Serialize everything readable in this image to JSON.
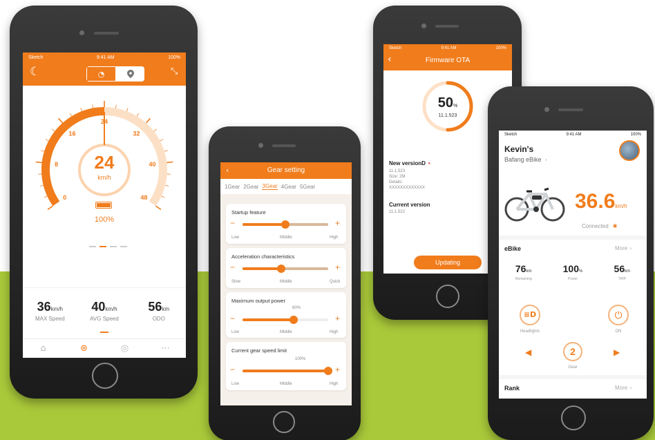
{
  "colors": {
    "accent": "#f07c1c",
    "band": "#a9c93a",
    "phone": "#222222"
  },
  "phone1": {
    "status": {
      "carrier": "Sketch",
      "time": "9:41 AM",
      "battery": "100%"
    },
    "tabs": [
      "speedometer-icon",
      "location-icon"
    ],
    "gauge": {
      "ticks": [
        "0",
        "8",
        "16",
        "24",
        "32",
        "40",
        "48"
      ],
      "speed": "24",
      "unit": "km/h",
      "battery_pct": "100%",
      "speed_fraction": 0.5
    },
    "stats": [
      {
        "value": "36",
        "unit": "km/h",
        "label": "MAX Speed"
      },
      {
        "value": "40",
        "unit": "km/h",
        "label": "AVG Speed"
      },
      {
        "value": "56",
        "unit": "km",
        "label": "ODO"
      }
    ],
    "nav": [
      "home-icon",
      "ride-icon",
      "compass-icon",
      "more-icon"
    ]
  },
  "phone2": {
    "title": "Gear setting",
    "gear_tabs": [
      "1Gear",
      "2Gear",
      "3Gear",
      "4Gear",
      "5Gear"
    ],
    "active_gear": "3Gear",
    "cards": [
      {
        "title": "Startup feature",
        "labels": [
          "Low",
          "Middle",
          "High"
        ],
        "value": 0.5,
        "pct": ""
      },
      {
        "title": "Acceleration characteristics",
        "labels": [
          "Slow",
          "Middle",
          "Quick"
        ],
        "value": 0.45,
        "pct": ""
      },
      {
        "title": "Maximum output power",
        "labels": [
          "Low",
          "Middle",
          "High"
        ],
        "value": 0.6,
        "pct": "60%"
      },
      {
        "title": "Current gear speed limit",
        "labels": [
          "Low",
          "Middle",
          "High"
        ],
        "value": 1.0,
        "pct": "100%"
      }
    ]
  },
  "phone3": {
    "status": {
      "carrier": "Sketch",
      "time": "9:41 AM",
      "battery": "100%"
    },
    "title": "Firmware OTA",
    "progress": "50",
    "progress_unit": "%",
    "progress_fraction": 0.5,
    "version": "11.1.523",
    "new_version_title": "New versionD",
    "new_version_lines": [
      "11.1.523",
      "Size: 2M",
      "Details:",
      "XXXXXXXXXXXXX"
    ],
    "current_version_title": "Current version",
    "current_version": "11.1.522",
    "button": "Updating"
  },
  "phone4": {
    "status": {
      "carrier": "Sketch",
      "time": "9:41 AM",
      "battery": "100%"
    },
    "owner": "Kevin's",
    "bike_name": "Bafang eBike",
    "speed": "36.6",
    "speed_unit": "km/h",
    "connection": "Connected",
    "section_ebike": "eBike",
    "more": "More",
    "metrics": [
      {
        "value": "76",
        "unit": "km",
        "label": "Remaining"
      },
      {
        "value": "100",
        "unit": "%",
        "label": "Power"
      },
      {
        "value": "56",
        "unit": "km",
        "label": "TRIP"
      }
    ],
    "headlights": "Headlights",
    "power": "ON",
    "gear": "2",
    "gear_label": "Gear",
    "section_rank": "Rank"
  }
}
